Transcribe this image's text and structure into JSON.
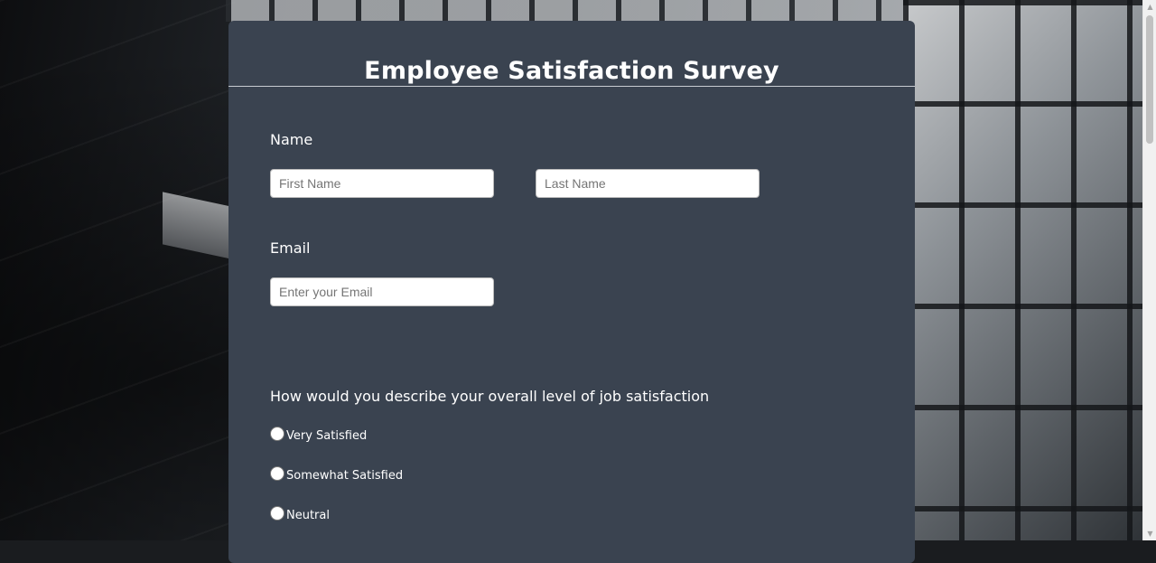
{
  "survey": {
    "title": "Employee Satisfaction Survey"
  },
  "name_section": {
    "label": "Name",
    "first_name_placeholder": "First Name",
    "last_name_placeholder": "Last Name"
  },
  "email_section": {
    "label": "Email",
    "email_placeholder": "Enter your Email"
  },
  "satisfaction_question": {
    "text": "How would you describe your overall level of job satisfaction",
    "options": [
      {
        "label": "Very Satisfied",
        "checked": false
      },
      {
        "label": "Somewhat Satisfied",
        "checked": false
      },
      {
        "label": "Neutral",
        "checked": false
      }
    ]
  },
  "colors": {
    "card_background": "#3a4350",
    "text": "#ffffff"
  }
}
